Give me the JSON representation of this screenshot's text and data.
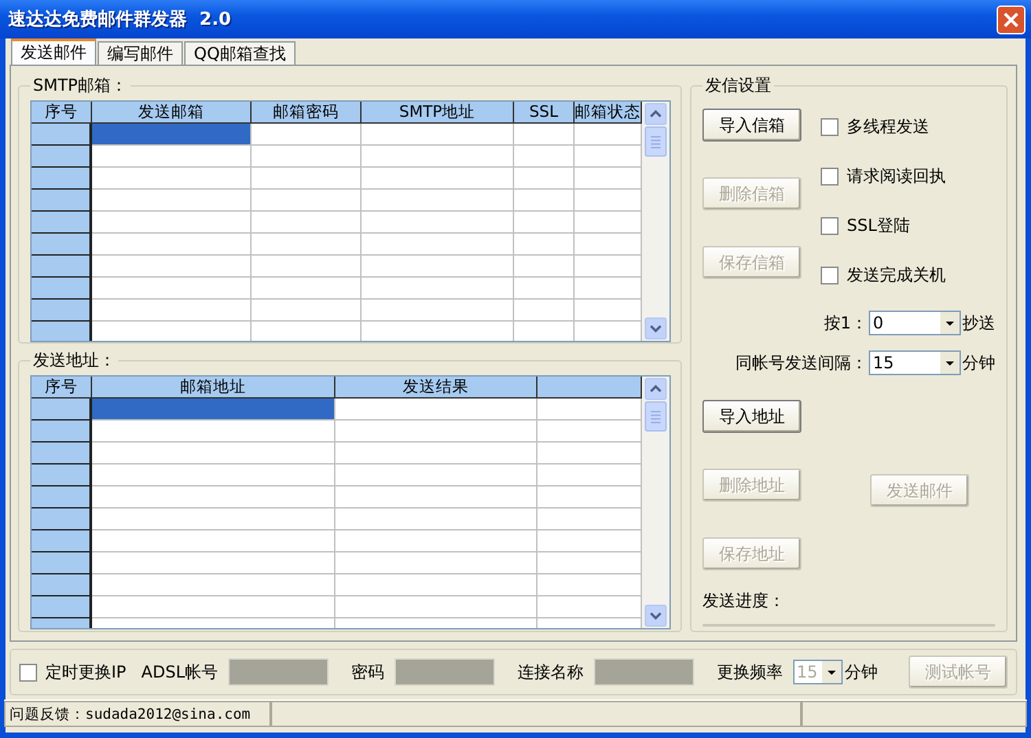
{
  "window": {
    "title": "速达达免费邮件群发器  2.0"
  },
  "tabs": [
    {
      "label": "发送邮件",
      "selected": true
    },
    {
      "label": "编写邮件",
      "selected": false
    },
    {
      "label": "QQ邮箱查找",
      "selected": false
    }
  ],
  "smtp_group": {
    "title": "SMTP邮箱：",
    "table": {
      "columns": [
        "序号",
        "发送邮箱",
        "邮箱密码",
        "SMTP地址",
        "SSL",
        "邮箱状态"
      ],
      "rows": [
        {
          "selected": true
        },
        {
          "selected": false
        },
        {
          "selected": false
        },
        {
          "selected": false
        },
        {
          "selected": false
        },
        {
          "selected": false
        },
        {
          "selected": false
        },
        {
          "selected": false
        },
        {
          "selected": false
        },
        {
          "selected": false
        }
      ]
    }
  },
  "address_group": {
    "title": "发送地址：",
    "table": {
      "columns": [
        "序号",
        "邮箱地址",
        "发送结果"
      ],
      "rows": [
        {
          "selected": true
        },
        {
          "selected": false
        },
        {
          "selected": false
        },
        {
          "selected": false
        },
        {
          "selected": false
        },
        {
          "selected": false
        },
        {
          "selected": false
        },
        {
          "selected": false
        },
        {
          "selected": false
        },
        {
          "selected": false
        },
        {
          "selected": false
        }
      ]
    }
  },
  "settings": {
    "title": "发信设置",
    "mailbox_buttons": [
      {
        "label": "导入信箱",
        "disabled": false
      },
      {
        "label": "删除信箱",
        "disabled": true
      },
      {
        "label": "保存信箱",
        "disabled": true
      }
    ],
    "checkboxes": [
      {
        "label": "多线程发送",
        "checked": false
      },
      {
        "label": "请求阅读回执",
        "checked": false
      },
      {
        "label": "SSL登陆",
        "checked": false
      },
      {
        "label": "发送完成关机",
        "checked": false
      }
    ],
    "cc": {
      "label": "按1：",
      "value": "0",
      "suffix": "抄送"
    },
    "interval": {
      "label": "同帐号发送间隔：",
      "value": "15",
      "suffix": "分钟"
    },
    "address_buttons": [
      {
        "label": "导入地址",
        "disabled": false
      },
      {
        "label": "删除地址",
        "disabled": true
      },
      {
        "label": "保存地址",
        "disabled": true
      }
    ],
    "send_button": {
      "label": "发送邮件",
      "disabled": true
    },
    "progress": {
      "label": "发送进度：",
      "level": 0
    }
  },
  "ip_change": {
    "checkbox": {
      "label": "定时更换IP",
      "checked": false
    },
    "fields": [
      {
        "label": "ADSL帐号",
        "disabled": true
      },
      {
        "label": "密码",
        "disabled": true
      },
      {
        "label": "连接名称",
        "disabled": true
      }
    ],
    "frequency": {
      "label": "更换频率",
      "value": "15",
      "suffix": "分钟",
      "disabled": true
    },
    "test_button": {
      "label": "测试帐号",
      "disabled": true
    }
  },
  "status_bar": [
    "问题反馈：sudada2012@sina.com"
  ]
}
